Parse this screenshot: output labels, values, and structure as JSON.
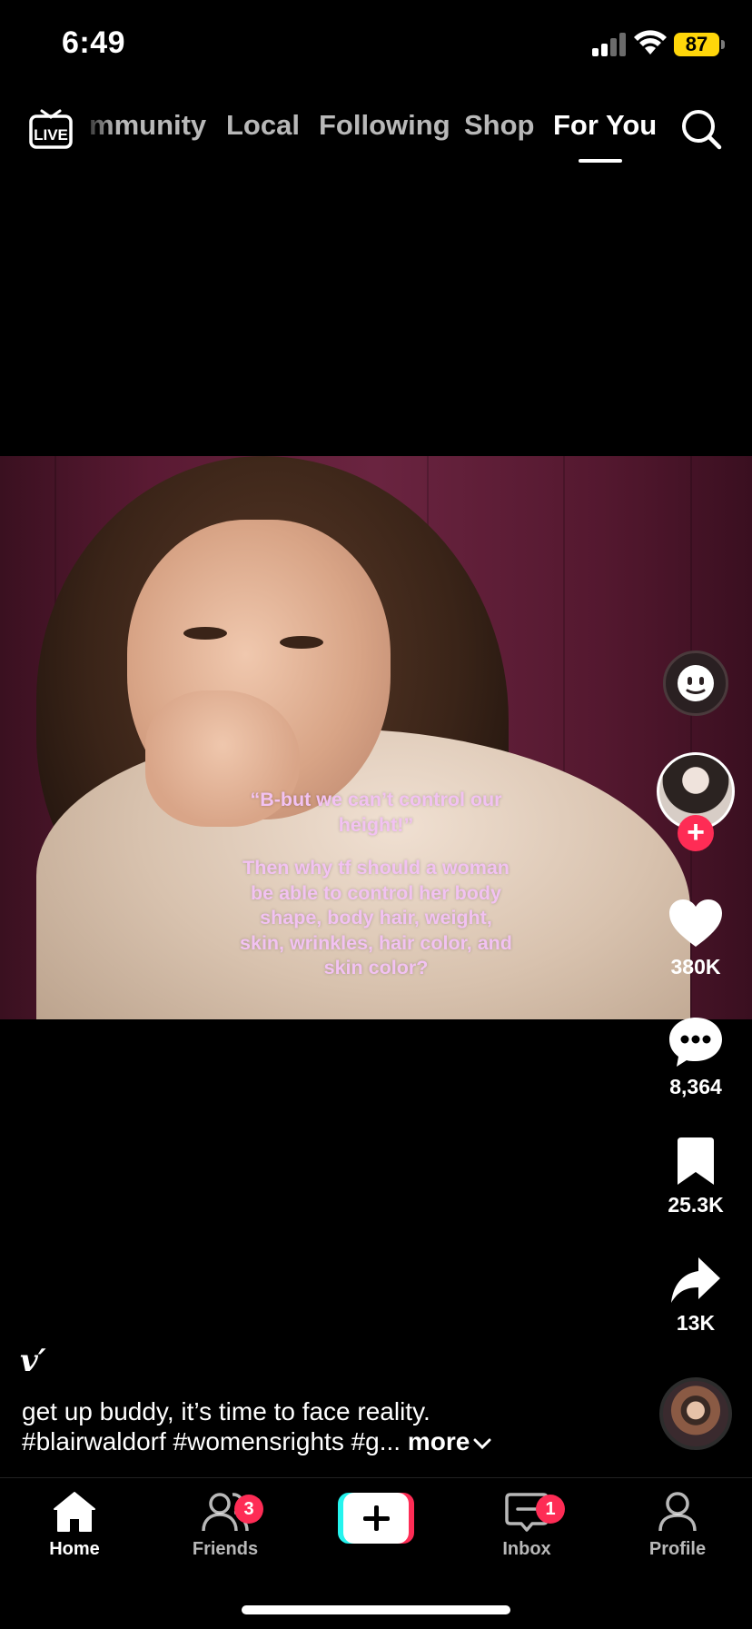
{
  "status_bar": {
    "time": "6:49",
    "battery": "87"
  },
  "top_nav": {
    "tabs": [
      "mmunity",
      "Local",
      "Following",
      "Shop",
      "For You"
    ],
    "active": "For You",
    "live_label": "LIVE"
  },
  "video": {
    "overlay_quote": "“B-but we can’t control our height!”",
    "overlay_text": "Then why tf should a woman be able to control her body shape, body hair, weight, skin, wrinkles, hair color, and skin color?"
  },
  "actions": {
    "likes": "380K",
    "comments": "8,364",
    "saves": "25.3K",
    "shares": "13K",
    "follow_symbol": "+"
  },
  "caption": {
    "logo": "v′",
    "line1": "get up buddy, it’s time to face reality.",
    "line2": "#blairwaldorf #womensrights #g...",
    "more": "more"
  },
  "tab_bar": {
    "home": "Home",
    "friends": "Friends",
    "friends_badge": "3",
    "inbox": "Inbox",
    "inbox_badge": "1",
    "profile": "Profile"
  },
  "colors": {
    "accent": "#fe2c55",
    "battery": "#ffd60a",
    "overlay_text": "#f2c2f2"
  }
}
